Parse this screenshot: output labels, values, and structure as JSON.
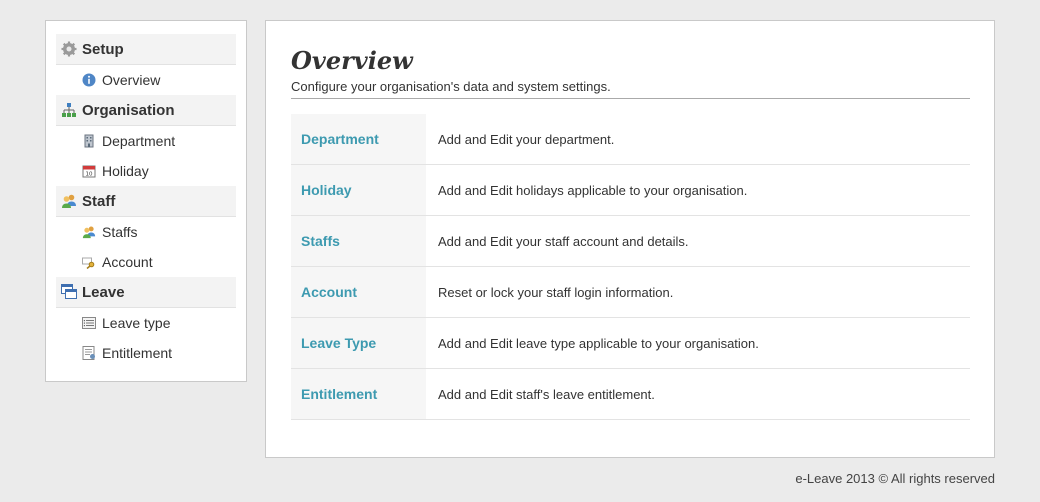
{
  "sidebar": {
    "sections": [
      {
        "label": "Setup",
        "icon": "gear-icon",
        "items": [
          {
            "label": "Overview",
            "icon": "info-icon"
          }
        ]
      },
      {
        "label": "Organisation",
        "icon": "org-chart-icon",
        "items": [
          {
            "label": "Department",
            "icon": "building-icon"
          },
          {
            "label": "Holiday",
            "icon": "calendar-icon"
          }
        ]
      },
      {
        "label": "Staff",
        "icon": "users-icon",
        "items": [
          {
            "label": "Staffs",
            "icon": "users-icon"
          },
          {
            "label": "Account",
            "icon": "key-icon"
          }
        ]
      },
      {
        "label": "Leave",
        "icon": "windows-icon",
        "items": [
          {
            "label": "Leave type",
            "icon": "list-icon"
          },
          {
            "label": "Entitlement",
            "icon": "form-icon"
          }
        ]
      }
    ]
  },
  "main": {
    "title": "Overview",
    "subtitle": "Configure your organisation's data and system settings.",
    "rows": [
      {
        "key": "Department",
        "desc": "Add and Edit your department."
      },
      {
        "key": "Holiday",
        "desc": "Add and Edit holidays applicable to your organisation."
      },
      {
        "key": "Staffs",
        "desc": "Add and Edit your staff account and details."
      },
      {
        "key": "Account",
        "desc": "Reset or lock your staff login information."
      },
      {
        "key": "Leave Type",
        "desc": "Add and Edit leave type applicable to your organisation."
      },
      {
        "key": "Entitlement",
        "desc": "Add and Edit staff's leave entitlement."
      }
    ]
  },
  "footer": {
    "text": "e-Leave 2013 © All rights reserved"
  },
  "colors": {
    "link": "#3d9ab0",
    "background": "#ebebeb"
  }
}
